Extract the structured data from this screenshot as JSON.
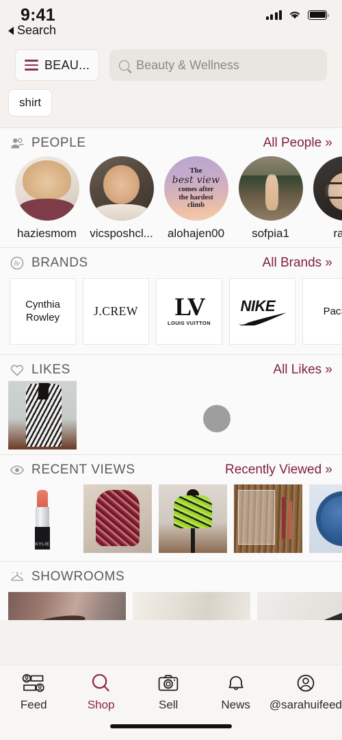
{
  "status_bar": {
    "time": "9:41",
    "signal_icon": "cellular-bars-icon",
    "wifi_icon": "wifi-icon",
    "battery_icon": "battery-icon"
  },
  "back": {
    "label": "Search",
    "icon": "back-caret-icon"
  },
  "search": {
    "category_label": "BEAU...",
    "category_icon": "hamburger-menu-icon",
    "placeholder": "Beauty & Wellness",
    "value": "Beauty & Wellness",
    "search_icon": "search-icon"
  },
  "filters": {
    "chips": [
      "shirt"
    ]
  },
  "colors": {
    "accent": "#8d2348",
    "link": "#7d2142",
    "section_title": "#5d5a57",
    "page_bg": "#f4f1ee",
    "card_bg": "#fbfafa"
  },
  "sections": {
    "people": {
      "title": "PEOPLE",
      "icon": "people-icon",
      "link": "All People »",
      "items": [
        {
          "name": "haziesmom",
          "avatar": "av-haziesmom"
        },
        {
          "name": "vicsposhcl...",
          "avatar": "av-vicsposhcl"
        },
        {
          "name": "alohajen00",
          "avatar": "av-quote",
          "quote_line1": "The",
          "quote_line2": "best view",
          "quote_line3": "comes after\nthe hardest\nclimb"
        },
        {
          "name": "sofpia1",
          "avatar": "av-sofpia1"
        },
        {
          "name": "raira",
          "avatar": "av-raira"
        }
      ]
    },
    "brands": {
      "title": "BRANDS",
      "icon": "brands-monogram-icon",
      "link": "All Brands »",
      "items": [
        {
          "name": "Cynthia Rowley",
          "style": "b-cynthia"
        },
        {
          "name": "J.CREW",
          "style": "b-jcrew"
        },
        {
          "name": "LV",
          "style": "b-lv",
          "sub": "LOUIS VUITTON"
        },
        {
          "name": "NIKE",
          "style": "b-nike"
        },
        {
          "name": "PacSun",
          "style": "b-pacsun",
          "display": "PacS"
        }
      ]
    },
    "likes": {
      "title": "LIKES",
      "icon": "heart-icon",
      "link": "All Likes »",
      "items": [
        {
          "alt": "patterned-jacket"
        }
      ],
      "loading_indicator": "loading-spinner"
    },
    "recent_views": {
      "title": "RECENT VIEWS",
      "icon": "eye-icon",
      "link": "Recently Viewed »",
      "items": [
        {
          "alt": "kylie-lipstick",
          "style": "rv-lipstick"
        },
        {
          "alt": "red-floral-top",
          "style": "rv-redtop"
        },
        {
          "alt": "green-print-top",
          "style": "rv-greentop"
        },
        {
          "alt": "lip-liners-on-wood",
          "style": "rv-wood"
        },
        {
          "alt": "blue-watch",
          "style": "rv-watch"
        }
      ]
    },
    "showrooms": {
      "title": "SHOWROOMS",
      "icon": "hanger-sparkle-icon",
      "link": "",
      "items": [
        {
          "alt": "eyebrow-makeup",
          "style": "sr-brow"
        },
        {
          "alt": "blonde-hair",
          "style": "sr-hair"
        },
        {
          "alt": "nail-polish",
          "style": "sr-nail"
        }
      ]
    }
  },
  "tabbar": {
    "items": [
      {
        "label": "Feed",
        "icon": "feed-icon",
        "active": false
      },
      {
        "label": "Shop",
        "icon": "search-icon",
        "active": true
      },
      {
        "label": "Sell",
        "icon": "camera-icon",
        "active": false
      },
      {
        "label": "News",
        "icon": "bell-icon",
        "active": false
      },
      {
        "label": "@sarahuifeed",
        "icon": "account-icon",
        "active": false
      }
    ]
  }
}
